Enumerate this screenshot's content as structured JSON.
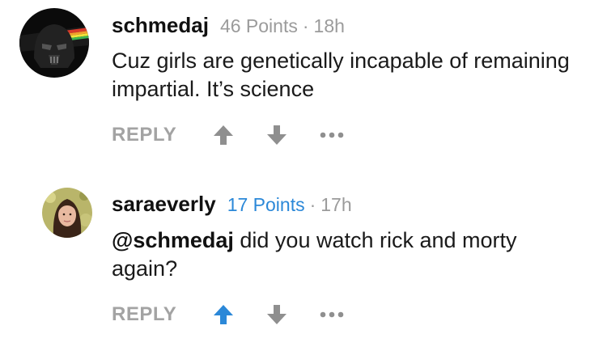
{
  "comments": [
    {
      "username": "schmedaj",
      "points": "46 Points",
      "separator": "·",
      "time": "18h",
      "text": "Cuz girls are genetically incapable of remaining impartial. It’s science",
      "reply_label": "REPLY",
      "upvoted": false,
      "avatar": "darth-vader-rainbow-avatar"
    },
    {
      "username": "saraeverly",
      "points": "17 Points",
      "separator": "·",
      "time": "17h",
      "mention": "@schmedaj",
      "text": " did you watch rick and morty again?",
      "reply_label": "REPLY",
      "upvoted": true,
      "avatar": "woman-portrait-avatar"
    }
  ],
  "colors": {
    "muted": "#9b9b9b",
    "action": "#8f8f8f",
    "accent_blue": "#2b88d8"
  }
}
